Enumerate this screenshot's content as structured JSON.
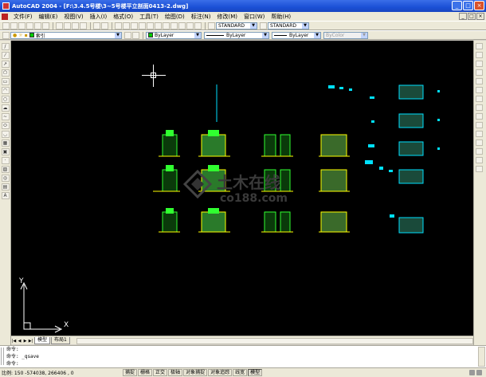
{
  "window": {
    "title": "AutoCAD 2004 - [F:\\3.4.5号楼\\3~5号楼平立剖面0413-2.dwg]",
    "buttons": [
      "_",
      "□",
      "×"
    ]
  },
  "menubar": {
    "items": [
      "文件(F)",
      "编辑(E)",
      "视图(V)",
      "插入(I)",
      "格式(O)",
      "工具(T)",
      "绘图(D)",
      "标注(N)",
      "修改(M)",
      "窗口(W)",
      "帮助(H)"
    ],
    "doc_buttons": [
      "_",
      "□",
      "×"
    ]
  },
  "styles_toolbar": {
    "text_style": "STANDARD",
    "dim_style": "STANDARD"
  },
  "properties_toolbar": {
    "layer": "索引",
    "color": "ByLayer",
    "linetype": "ByLayer",
    "lineweight": "ByLayer",
    "plotstyle": "ByColor",
    "color_accent": "#00c000"
  },
  "layout_tabs": {
    "nav": [
      "|◀",
      "◀",
      "▶",
      "▶|"
    ],
    "tabs": [
      "模型",
      "布局1"
    ]
  },
  "ucs": {
    "y_label": "Y",
    "x_label": "X"
  },
  "command": {
    "lines": [
      "命令:",
      "命令: _qsave",
      "命令:"
    ]
  },
  "status": {
    "coords": "比例: 150 -574038, 266406 , 0",
    "buttons": [
      {
        "label": "捕捉",
        "on": false
      },
      {
        "label": "栅格",
        "on": false
      },
      {
        "label": "正交",
        "on": false
      },
      {
        "label": "极轴",
        "on": false
      },
      {
        "label": "对象捕捉",
        "on": false
      },
      {
        "label": "对象追踪",
        "on": false
      },
      {
        "label": "线宽",
        "on": false
      },
      {
        "label": "模型",
        "on": true
      }
    ]
  },
  "watermark": {
    "cn": "土木在线",
    "en": "co188.com"
  },
  "colors": {
    "canvas_bg": "#000000",
    "drawing_green": "#30ff30",
    "drawing_yellow": "#ffff00",
    "drawing_cyan": "#00e0ff",
    "titlebar": "#1b50d6"
  }
}
